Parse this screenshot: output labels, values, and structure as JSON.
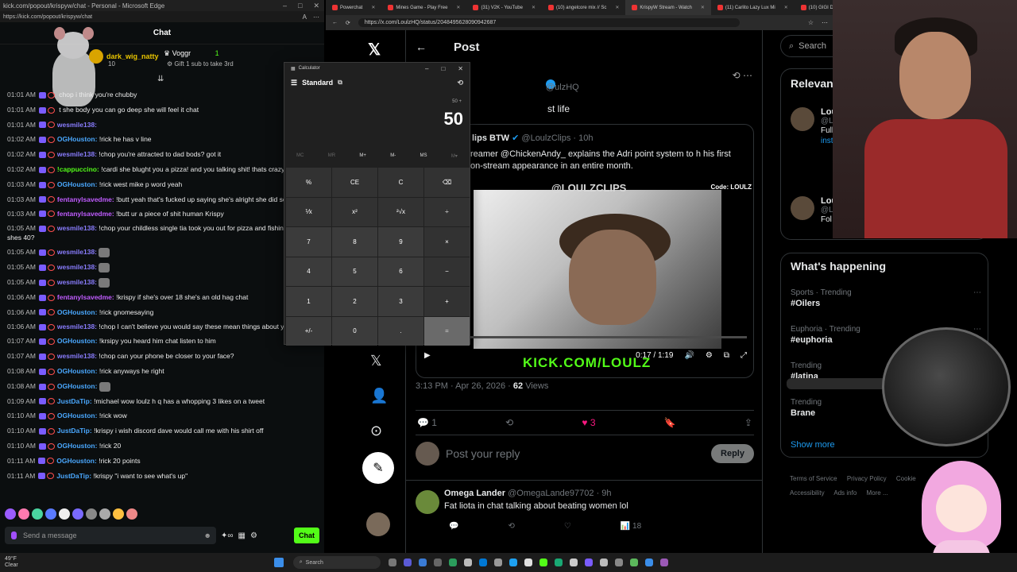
{
  "left_window": {
    "title": "kick.com/popout/krispyw/chat - Personal - Microsoft Edge",
    "url": "https://kick.com/popout/krispyw/chat",
    "header": "Chat",
    "pinned": {
      "gifter": "dark_wig_natty",
      "gifter_count": "10",
      "user2": "Voggr",
      "user2_count": "1",
      "sub_note": "Gift 1 sub to take 3rd"
    },
    "messages": [
      {
        "time": "01:01 AM",
        "user": "",
        "text": "chop i think you're chubby",
        "color": "#ececec"
      },
      {
        "time": "01:01 AM",
        "user": "",
        "text": "t she body you can go deep she will feel it chat",
        "color": "#ececec"
      },
      {
        "time": "01:01 AM",
        "user": "wesmile138:",
        "text": "",
        "color": "#8a7dff"
      },
      {
        "time": "01:02 AM",
        "user": "OGHouston:",
        "text": "!rick",
        "tail": "he has v line",
        "color": "#4aa8ff"
      },
      {
        "time": "01:02 AM",
        "user": "wesmile138:",
        "text": "!chop you're attracted to dad bods? got it",
        "color": "#8a7dff"
      },
      {
        "time": "01:02 AM",
        "user": "!cappuccino:",
        "text": "!cardi she blught you a pizza! and you talking shit! thats crazy",
        "color": "#53fc18"
      },
      {
        "time": "01:03 AM",
        "user": "OGHouston:",
        "text": "!rick west mike p word yeah",
        "color": "#4aa8ff"
      },
      {
        "time": "01:03 AM",
        "user": "fentanylsavedme:",
        "text": "!butt yeah that's fucked up saying she's alright she did so m today",
        "color": "#c05cff",
        "wrap": true
      },
      {
        "time": "01:03 AM",
        "user": "fentanylsavedme:",
        "text": "!butt ur a piece of shit human Krispy",
        "color": "#c05cff"
      },
      {
        "time": "01:05 AM",
        "user": "wesmile138:",
        "text": "!chop your childless single tia took you out for pizza and fishing a say shes 40?",
        "color": "#8a7dff",
        "wrap": true
      },
      {
        "time": "01:05 AM",
        "user": "wesmile138:",
        "text": "",
        "color": "#8a7dff",
        "emote": true
      },
      {
        "time": "01:05 AM",
        "user": "wesmile138:",
        "text": "",
        "color": "#8a7dff",
        "emote": true
      },
      {
        "time": "01:05 AM",
        "user": "wesmile138:",
        "text": "",
        "color": "#8a7dff",
        "emote": true
      },
      {
        "time": "01:06 AM",
        "user": "fentanylsavedme:",
        "text": "!krispy if she's over 18 she's an old hag chat",
        "color": "#c05cff"
      },
      {
        "time": "01:06 AM",
        "user": "OGHouston:",
        "text": "!rick gnomesaying",
        "color": "#4aa8ff"
      },
      {
        "time": "01:06 AM",
        "user": "wesmile138:",
        "text": "!chop I can't believe you would say these mean things about you tia",
        "color": "#8a7dff",
        "wrap": true
      },
      {
        "time": "01:07 AM",
        "user": "OGHouston:",
        "text": "!krsipy you heard him chat listen to him",
        "color": "#4aa8ff"
      },
      {
        "time": "01:07 AM",
        "user": "wesmile138:",
        "text": "!chop can your phone be closer to your face?",
        "color": "#8a7dff"
      },
      {
        "time": "01:08 AM",
        "user": "OGHouston:",
        "text": "!rick anyways he right",
        "color": "#4aa8ff"
      },
      {
        "time": "01:08 AM",
        "user": "OGHouston:",
        "text": "",
        "color": "#4aa8ff",
        "emote": true
      },
      {
        "time": "01:09 AM",
        "user": "JustDaTip:",
        "text": "!michael wow loulz h q has a whopping 3 likes on a tweet",
        "color": "#4aa8ff"
      },
      {
        "time": "01:10 AM",
        "user": "OGHouston:",
        "text": "!rick wow",
        "color": "#4aa8ff"
      },
      {
        "time": "01:10 AM",
        "user": "JustDaTip:",
        "text": "!krispy i wish discord dave would call me with his shirt off",
        "color": "#4aa8ff"
      },
      {
        "time": "01:10 AM",
        "user": "OGHouston:",
        "text": "!rick 20",
        "color": "#4aa8ff"
      },
      {
        "time": "01:11 AM",
        "user": "OGHouston:",
        "text": "!rick 20 points",
        "color": "#4aa8ff"
      },
      {
        "time": "01:11 AM",
        "user": "JustDaTip:",
        "text": "!krispy \"i want to see what's up\"",
        "color": "#4aa8ff"
      }
    ],
    "send_placeholder": "Send a message",
    "chat_button": "Chat"
  },
  "right_window": {
    "tabs": [
      {
        "label": "Powerchat",
        "active": false
      },
      {
        "label": "Mines Game - Play Free",
        "active": false
      },
      {
        "label": "(31) V2K - YouTube",
        "active": false
      },
      {
        "label": "(10) angelcore mix // Sc",
        "active": false
      },
      {
        "label": "KrispyW Stream - Watch",
        "active": true
      },
      {
        "label": "(11) Carlito Lazy Lux Mi",
        "active": false
      },
      {
        "label": "(10) GIGI D'A",
        "active": false
      }
    ],
    "url": "https://x.com/LoulzHQ/status/2048495628090942687",
    "header_title": "Post",
    "author_handle": "@ulzHQ",
    "tweet_text": "st life",
    "quote": {
      "name": "lips BTW",
      "handle": "@LoulzClips · 10h",
      "text": "reamer @ChickenAndy_ explains the Adri point system to h his first on-stream appearance in an entire month.",
      "watermark1": "@LOULZCLIPS",
      "watermark2": "Code: LOULZ",
      "kick": "KICK.COM/LOULZ",
      "time": "0:17 / 1:19",
      "progress": 0.14
    },
    "meta_time": "3:13 PM · Apr 26, 2026 · ",
    "meta_views": "62",
    "meta_views_label": " Views",
    "actions": {
      "replies": "1",
      "reposts": "",
      "likes": "3"
    },
    "reply_placeholder": "Post your reply",
    "reply_button": "Reply",
    "reply_tweet": {
      "name": "Omega Lander",
      "handle": "@OmegaLande97702 · 9h",
      "text": "Fat liota in chat talking about beating women lol",
      "views": "18"
    },
    "search_placeholder": "Search",
    "relevant": {
      "title": "Relevan",
      "items": [
        {
          "name": "Lou",
          "handle": "@L",
          "bio": "Full Par",
          "link": "inst dis"
        },
        {
          "name": "Lou",
          "handle": "@L",
          "bio": "Fol",
          "link": ""
        }
      ]
    },
    "happening": {
      "title": "What's happening",
      "trends": [
        {
          "context": "Sports · Trending",
          "name": "#Oilers"
        },
        {
          "context": "Euphoria · Trending",
          "name": "#euphoria"
        },
        {
          "context": "Trending",
          "name": "#latina"
        },
        {
          "context": "Trending",
          "name": "Brane"
        }
      ],
      "show_more": "Show more"
    },
    "footer": [
      "Terms of Service",
      "Privacy Policy",
      "Cookie",
      "Accessibility",
      "Ads info",
      "More ..."
    ]
  },
  "calculator": {
    "title": "Calculator",
    "mode": "Standard",
    "expression": "50 +",
    "display": "50",
    "memory": [
      "MC",
      "MR",
      "M+",
      "M-",
      "MS",
      "M▾"
    ],
    "keys": [
      "%",
      "CE",
      "C",
      "⌫",
      "⅟x",
      "x²",
      "²√x",
      "÷",
      "7",
      "8",
      "9",
      "×",
      "4",
      "5",
      "6",
      "−",
      "1",
      "2",
      "3",
      "+",
      "+/-",
      "0",
      ".",
      "="
    ]
  },
  "taskbar": {
    "weather_temp": "49°F",
    "weather_desc": "Clear",
    "search": "Search"
  }
}
